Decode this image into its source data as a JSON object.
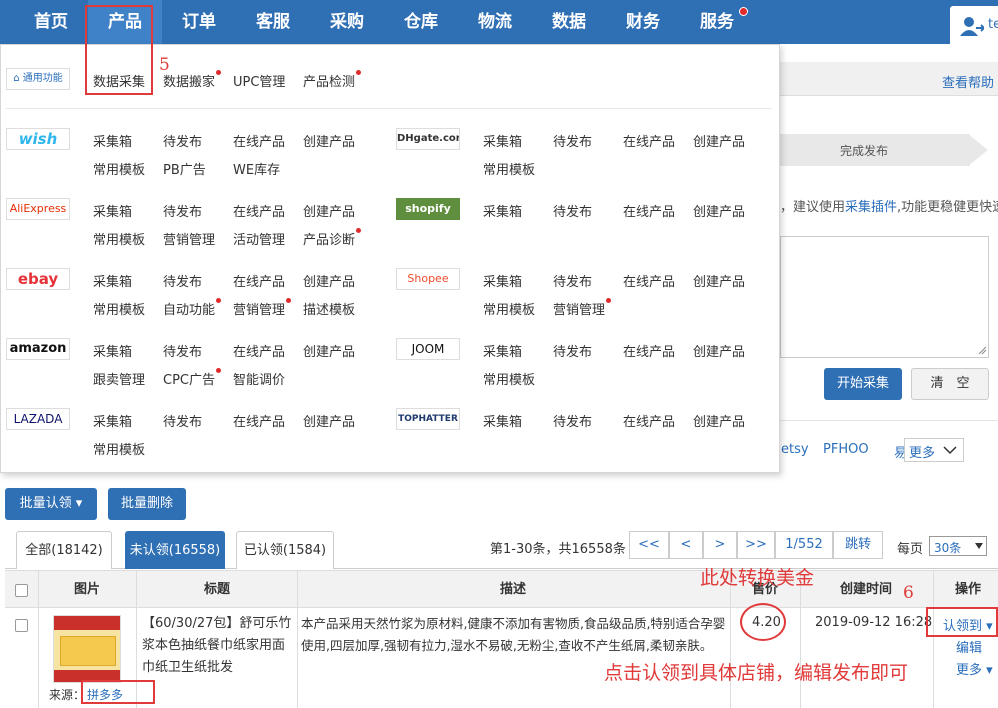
{
  "nav": {
    "items": [
      "首页",
      "产品",
      "订单",
      "客服",
      "采购",
      "仓库",
      "物流",
      "数据",
      "财务",
      "服务"
    ],
    "user_initials": "te"
  },
  "background": {
    "help": "查看帮助",
    "step": "完成发布",
    "tip_prefix": "，建议使用",
    "tip_link": "采集插件",
    "tip_suffix": ",功能更稳健更快速",
    "start_btn": "开始采集",
    "clear_btn": "清　空",
    "platform_etsy": "etsy",
    "platform_pfhoo": "PFHOO",
    "platform_more_a": "易",
    "platform_more_b": "更多"
  },
  "panel": {
    "general_label": "通用功能",
    "general_links": [
      "数据采集",
      "数据搬家",
      "UPC管理",
      "产品检测"
    ],
    "platforms": [
      {
        "logo": "wish",
        "row1": [
          "采集箱",
          "待发布",
          "在线产品",
          "创建产品"
        ],
        "row2": [
          "常用模板",
          "PB广告",
          "WE库存"
        ]
      },
      {
        "logo": "DHgate.com",
        "row1": [
          "采集箱",
          "待发布",
          "在线产品",
          "创建产品"
        ],
        "row2": [
          "常用模板"
        ]
      },
      {
        "logo": "AliExpress",
        "row1": [
          "采集箱",
          "待发布",
          "在线产品",
          "创建产品"
        ],
        "row2": [
          "常用模板",
          "营销管理",
          "活动管理",
          "产品诊断"
        ]
      },
      {
        "logo": "shopify",
        "row1": [
          "采集箱",
          "待发布",
          "在线产品",
          "创建产品"
        ],
        "row2": []
      },
      {
        "logo": "ebay",
        "row1": [
          "采集箱",
          "待发布",
          "在线产品",
          "创建产品"
        ],
        "row2": [
          "常用模板",
          "自动功能",
          "营销管理",
          "描述模板"
        ]
      },
      {
        "logo": "Shopee",
        "row1": [
          "采集箱",
          "待发布",
          "在线产品",
          "创建产品"
        ],
        "row2": [
          "常用模板",
          "营销管理"
        ]
      },
      {
        "logo": "amazon",
        "row1": [
          "采集箱",
          "待发布",
          "在线产品",
          "创建产品"
        ],
        "row2": [
          "跟卖管理",
          "CPC广告",
          "智能调价"
        ]
      },
      {
        "logo": "JOOM",
        "row1": [
          "采集箱",
          "待发布",
          "在线产品",
          "创建产品"
        ],
        "row2": [
          "常用模板"
        ]
      },
      {
        "logo": "LAZADA",
        "row1": [
          "采集箱",
          "待发布",
          "在线产品",
          "创建产品"
        ],
        "row2": [
          "常用模板"
        ]
      },
      {
        "logo": "TOPHATTER",
        "row1": [
          "采集箱",
          "待发布",
          "在线产品",
          "创建产品"
        ],
        "row2": []
      }
    ]
  },
  "annotations": {
    "n5": "5",
    "n6": "6",
    "usd": "此处转换美金",
    "claim_hint": "点击认领到具体店铺，编辑发布即可"
  },
  "toolbar": {
    "batch_claim": "批量认领 ▾",
    "batch_delete": "批量删除"
  },
  "tabs": [
    "全部(18142)",
    "未认领(16558)",
    "已认领(1584)"
  ],
  "pager": {
    "summary": "第1-30条，共16558条",
    "first": "<<",
    "prev": "<",
    "next": ">",
    "last": ">>",
    "page": "1/552",
    "jump": "跳转",
    "per_page_label": "每页",
    "per_page": "30条"
  },
  "table": {
    "headers": [
      "图片",
      "标题",
      "描述",
      "售价",
      "创建时间",
      "操作"
    ],
    "row": {
      "title": "【60/30/27包】舒可乐竹浆本色抽纸餐巾纸家用面巾纸卫生纸批发",
      "description": "本产品采用天然竹浆为原材料,健康不添加有害物质,食品级品质,特别适合孕婴使用,四层加厚,强韧有拉力,湿水不易破,无粉尘,查收不产生纸屑,柔韧亲肤。",
      "price": "4.20",
      "created": "2019-09-12 16:28",
      "source_label": "来源：",
      "source": "拼多多",
      "actions": [
        "认领到 ▾",
        "编辑",
        "更多 ▾"
      ]
    }
  }
}
